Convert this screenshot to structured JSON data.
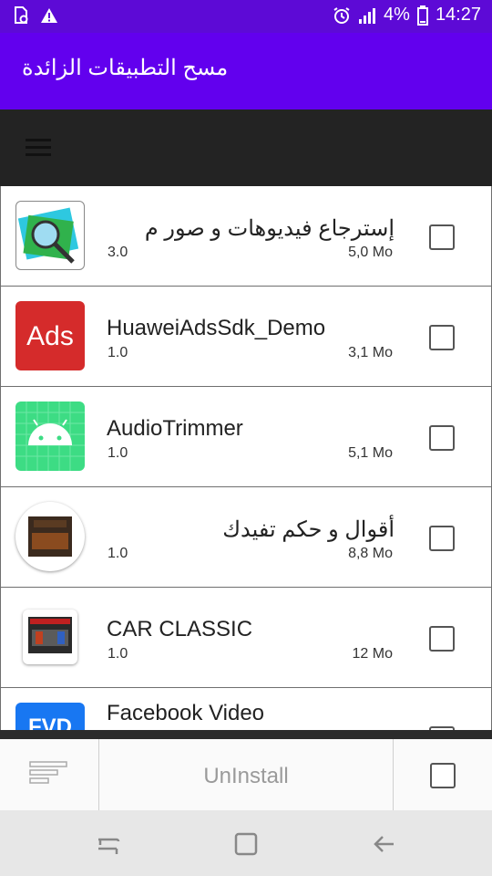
{
  "status_bar": {
    "battery_percent": "4%",
    "time": "14:27",
    "icons": [
      "sim-card-icon",
      "warning-icon",
      "alarm-icon",
      "signal-icon",
      "battery-icon"
    ]
  },
  "app_bar": {
    "title": "مسح التطبيقات الزائدة"
  },
  "toolbar": {
    "menu_icon": "menu-icon"
  },
  "apps": [
    {
      "name": "إسترجاع فيديوهات و صور م",
      "version": "3.0",
      "size": "5,0 Mo",
      "icon": "photo-recovery-icon",
      "checked": false
    },
    {
      "name": "HuaweiAdsSdk_Demo",
      "version": "1.0",
      "size": "3,1 Mo",
      "icon": "ads-icon",
      "checked": false
    },
    {
      "name": "AudioTrimmer",
      "version": "1.0",
      "size": "5,1 Mo",
      "icon": "android-icon",
      "checked": false
    },
    {
      "name": "أقوال و حكم تفيدك",
      "version": "1.0",
      "size": "8,8 Mo",
      "icon": "book-app-icon",
      "checked": false
    },
    {
      "name": "CAR CLASSIC",
      "version": "1.0",
      "size": "12 Mo",
      "icon": "car-game-icon",
      "checked": false
    },
    {
      "name": "Facebook Video",
      "version": "",
      "size": "",
      "icon": "fvd-icon",
      "checked": false
    }
  ],
  "bottom_bar": {
    "sort_icon": "sort-icon",
    "uninstall_label": "UnInstall",
    "select_all_checked": false
  },
  "nav_bar": {
    "icons": [
      "recents-icon",
      "home-icon",
      "back-icon"
    ]
  },
  "colors": {
    "status_bar": "#5d0ad6",
    "app_bar": "#6200ee",
    "toolbar": "#232323",
    "ads_icon_bg": "#d52b2b",
    "android_icon_bg": "#3ddc84",
    "fvd_icon_bg": "#1877f2"
  }
}
